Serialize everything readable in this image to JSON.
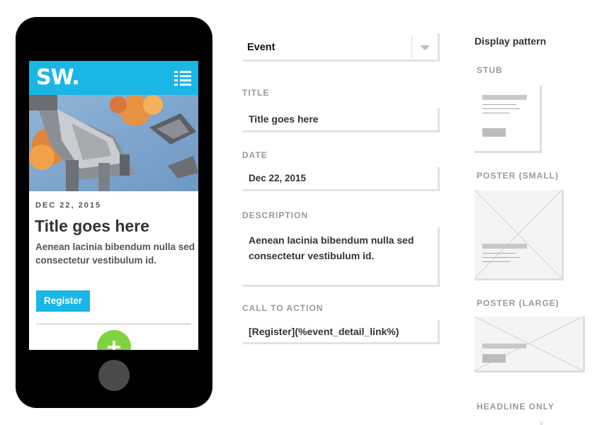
{
  "mobile_preview": {
    "logo": "SW.",
    "date": "DEC 22, 2015",
    "title": "Title goes here",
    "description": "Aenean lacinia bibendum nulla sed consectetur vestibulum id.",
    "button_label": "Register",
    "icons": {
      "menu": "menu-icon",
      "add": "plus-icon"
    },
    "colors": {
      "header": "#1ab6e6",
      "button": "#1ab6e6",
      "fab": "#7ed43f"
    }
  },
  "form": {
    "type_select": {
      "value": "Event"
    },
    "title": {
      "label": "TITLE",
      "value": "Title goes here"
    },
    "date": {
      "label": "DATE",
      "value": "Dec 22, 2015"
    },
    "description": {
      "label": "DESCRIPTION",
      "value": "Aenean lacinia bibendum nulla sed consectetur vestibulum id."
    },
    "call_to_action": {
      "label": "CALL TO ACTION",
      "value": "[Register](%event_detail_link%)"
    }
  },
  "display_pattern": {
    "heading": "Display pattern",
    "options": [
      {
        "label": "STUB"
      },
      {
        "label": "POSTER (SMALL)"
      },
      {
        "label": "POSTER (LARGE)"
      },
      {
        "label": "HEADLINE ONLY"
      }
    ]
  }
}
